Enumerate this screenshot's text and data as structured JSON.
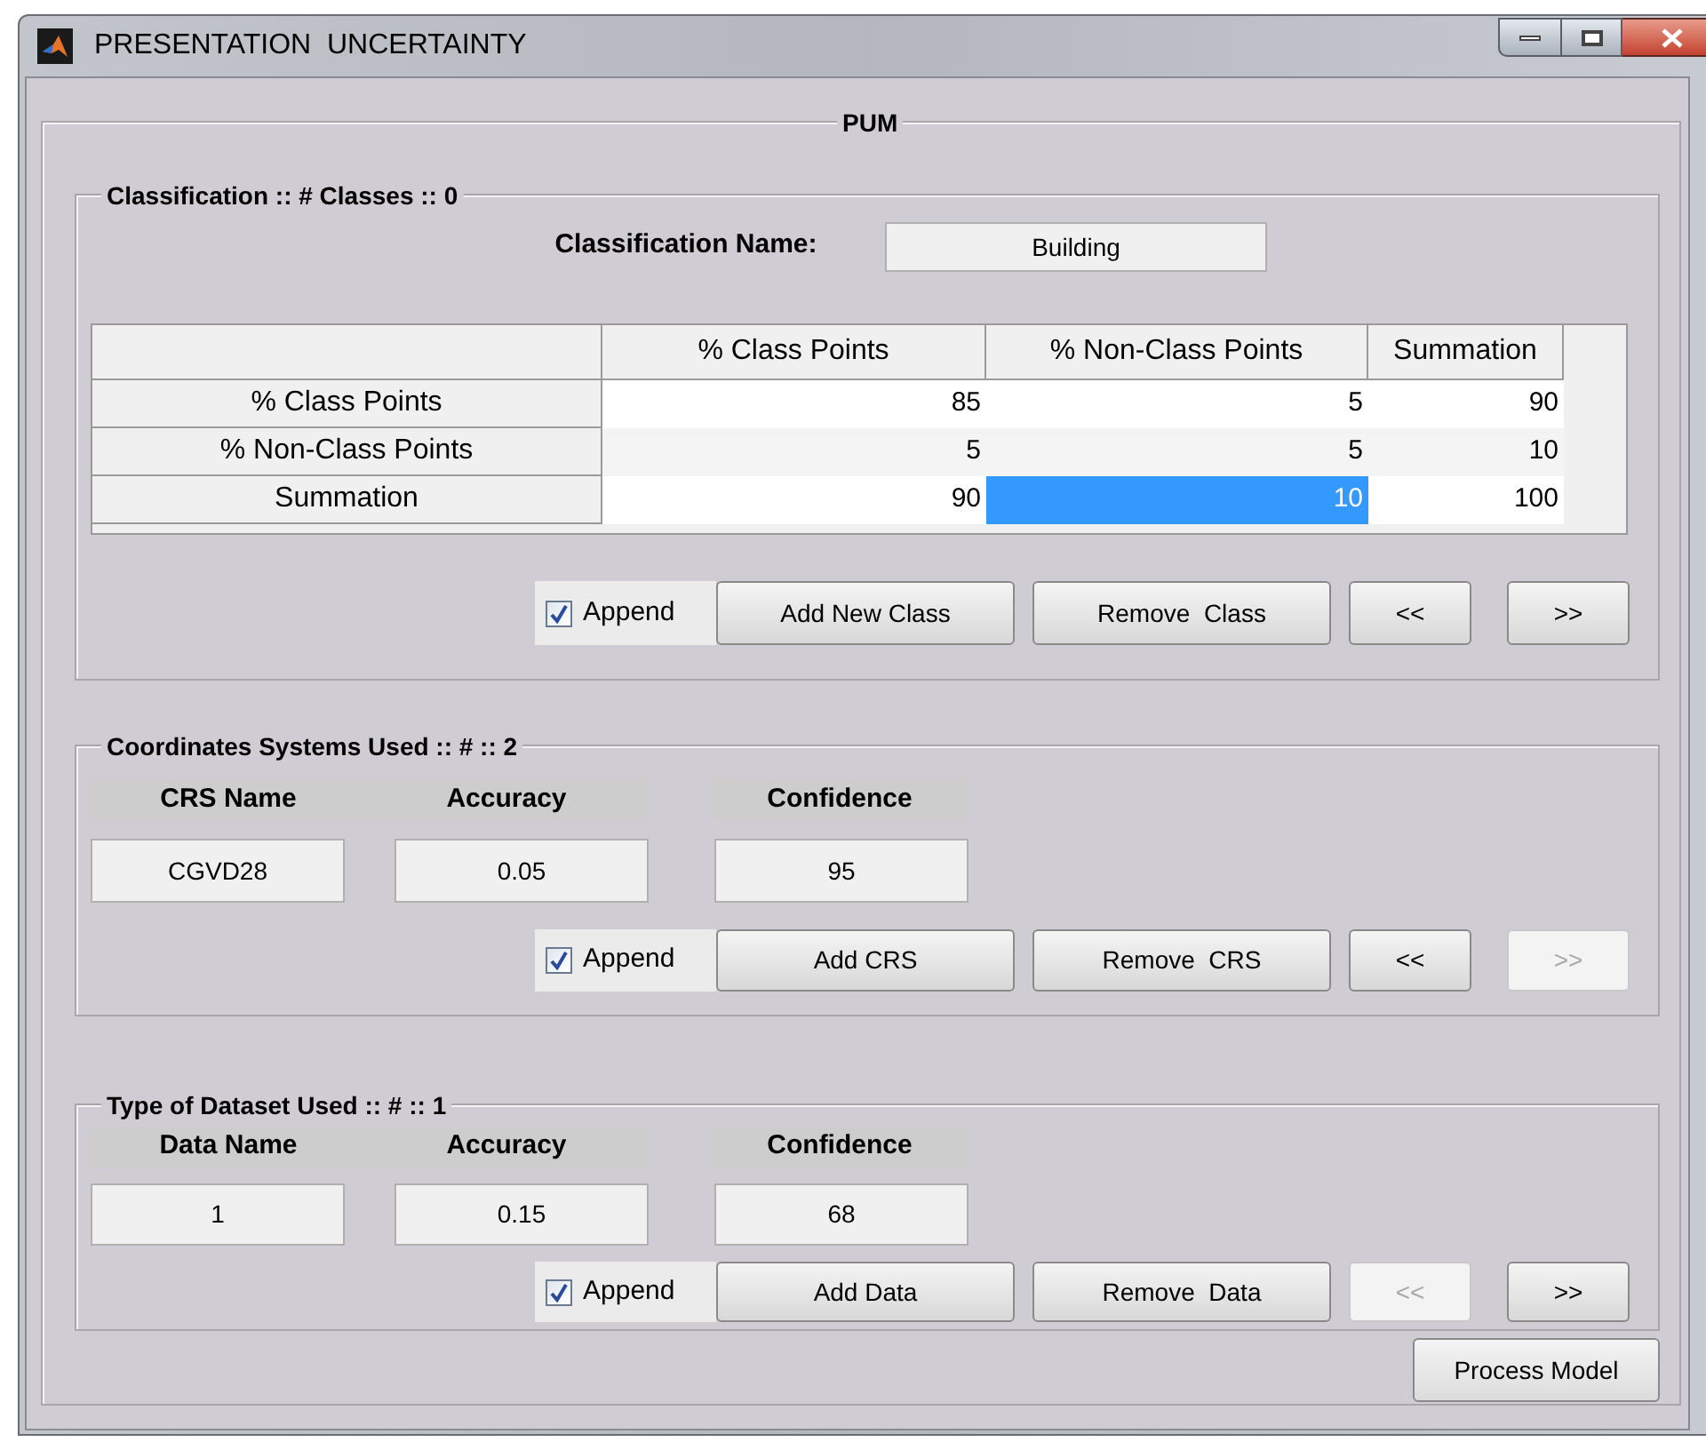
{
  "window": {
    "title": "PRESENTATION  UNCERTAINTY"
  },
  "panel": {
    "title": "PUM"
  },
  "classification": {
    "title": "Classification :: # Classes :: 0",
    "name_label": "Classification Name:",
    "name_value": "Building",
    "table": {
      "columns": [
        "% Class Points",
        "% Non-Class Points",
        "Summation"
      ],
      "rows": [
        {
          "header": "% Class Points",
          "cells": [
            {
              "value": "85",
              "selected": false
            },
            {
              "value": "5",
              "selected": false
            },
            {
              "value": "90",
              "selected": false
            }
          ]
        },
        {
          "header": "% Non-Class Points",
          "cells": [
            {
              "value": "5",
              "selected": false
            },
            {
              "value": "5",
              "selected": false
            },
            {
              "value": "10",
              "selected": false
            }
          ]
        },
        {
          "header": "Summation",
          "cells": [
            {
              "value": "90",
              "selected": false
            },
            {
              "value": "10",
              "selected": true
            },
            {
              "value": "100",
              "selected": false
            }
          ]
        }
      ]
    },
    "append": {
      "label": "Append",
      "checked": true
    },
    "buttons": [
      {
        "label": "Add New Class",
        "disabled": false
      },
      {
        "label": "Remove  Class",
        "disabled": false
      },
      {
        "label": "<<",
        "disabled": false
      },
      {
        "label": ">>",
        "disabled": false
      }
    ]
  },
  "crs": {
    "title": "Coordinates Systems Used :: # :: 2",
    "labels": [
      "CRS Name",
      "Accuracy",
      "Confidence"
    ],
    "values": [
      "CGVD28",
      "0.05",
      "95"
    ],
    "append": {
      "label": "Append",
      "checked": true
    },
    "buttons": [
      {
        "label": "Add CRS",
        "disabled": false
      },
      {
        "label": "Remove  CRS",
        "disabled": false
      },
      {
        "label": "<<",
        "disabled": false
      },
      {
        "label": ">>",
        "disabled": true
      }
    ]
  },
  "dataset": {
    "title": "Type of Dataset Used :: # :: 1",
    "labels": [
      "Data Name",
      "Accuracy",
      "Confidence"
    ],
    "values": [
      "1",
      "0.15",
      "68"
    ],
    "append": {
      "label": "Append",
      "checked": true
    },
    "buttons": [
      {
        "label": "Add Data",
        "disabled": false
      },
      {
        "label": "Remove  Data",
        "disabled": false
      },
      {
        "label": "<<",
        "disabled": true
      },
      {
        "label": ">>",
        "disabled": false
      }
    ]
  },
  "process_button": {
    "label": "Process Model"
  }
}
